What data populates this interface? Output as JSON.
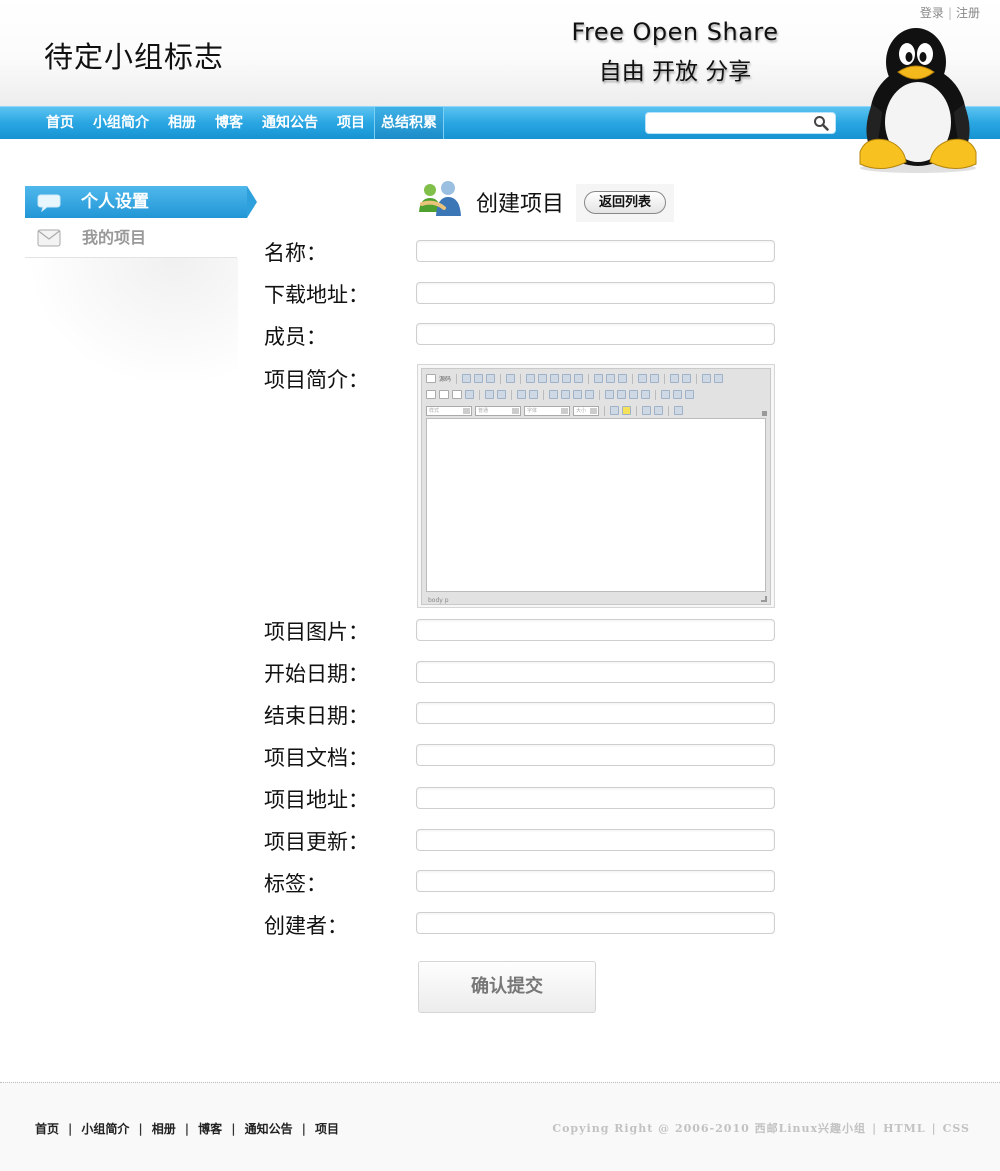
{
  "header": {
    "logo_text": "待定小组标志",
    "slogan_en": "Free Open Share",
    "slogan_zh": "自由 开放 分享",
    "top_links": {
      "login": "登录",
      "separator": "|",
      "register": "注册"
    }
  },
  "nav": {
    "items": [
      {
        "label": "首页"
      },
      {
        "label": "小组简介"
      },
      {
        "label": "相册"
      },
      {
        "label": "博客"
      },
      {
        "label": "通知公告"
      },
      {
        "label": "项目"
      },
      {
        "label": "总结积累",
        "active": true
      }
    ],
    "search": {
      "value": "",
      "placeholder": ""
    }
  },
  "sidebar": {
    "items": [
      {
        "label": "个人设置",
        "active": true,
        "icon": "speech-bubble-icon"
      },
      {
        "label": "我的项目",
        "active": false,
        "icon": "envelope-icon"
      }
    ]
  },
  "form": {
    "title": "创建项目",
    "back_button": "返回列表",
    "fields": [
      {
        "label": "名称：",
        "value": ""
      },
      {
        "label": "下载地址：",
        "value": ""
      },
      {
        "label": "成员：",
        "value": ""
      },
      {
        "label": "项目简介：",
        "value": ""
      },
      {
        "label": "项目图片：",
        "value": ""
      },
      {
        "label": "开始日期：",
        "value": ""
      },
      {
        "label": "结束日期：",
        "value": ""
      },
      {
        "label": "项目文档：",
        "value": ""
      },
      {
        "label": "项目地址：",
        "value": ""
      },
      {
        "label": "项目更新：",
        "value": ""
      },
      {
        "label": "标签：",
        "value": ""
      },
      {
        "label": "创建者：",
        "value": ""
      }
    ],
    "editor": {
      "source_label": "源码",
      "combo_style": "样式",
      "combo_format": "普通",
      "combo_font": "字体",
      "combo_size": "大小",
      "status_path": "body p"
    },
    "submit_button": "确认提交"
  },
  "footer": {
    "links": [
      "首页",
      "小组简介",
      "相册",
      "博客",
      "通知公告",
      "项目"
    ],
    "separator": "|",
    "copyright": "Copying Right @ 2006-2010 西邮Linux兴趣小组",
    "tech_links": [
      "HTML",
      "CSS"
    ]
  },
  "colors": {
    "nav_blue": "#29a6e2",
    "sidebar_active": "#2296d6",
    "text": "#111111",
    "muted": "#999999"
  }
}
